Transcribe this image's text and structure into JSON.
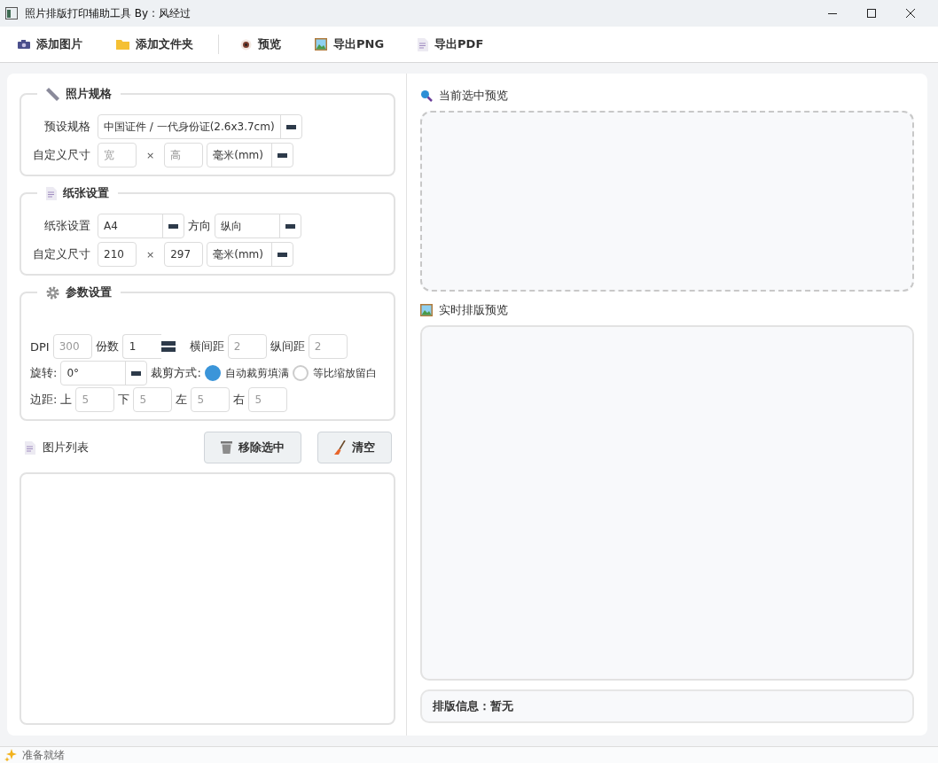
{
  "window": {
    "title": "照片排版打印辅助工具 By : 风经过"
  },
  "toolbar": {
    "groups": [
      {
        "buttons": [
          "添加图片",
          "添加文件夹"
        ]
      },
      {
        "buttons": [
          "预览",
          "导出PNG",
          "导出PDF"
        ]
      }
    ]
  },
  "sections": [
    {
      "title": "照片规格",
      "lines": [
        {
          "items": [
            {
              "kind": "label",
              "text": "预设规格"
            },
            {
              "kind": "select",
              "value": "中国证件 / 一代身份证(2.6x3.7cm)"
            }
          ]
        },
        {
          "items": [
            {
              "kind": "label",
              "text": "自定义尺寸"
            },
            {
              "kind": "input",
              "placeholder": "宽"
            },
            {
              "kind": "times",
              "text": "×"
            },
            {
              "kind": "input",
              "placeholder": "高"
            },
            {
              "kind": "select",
              "value": "毫米(mm)"
            }
          ]
        }
      ]
    },
    {
      "title": "纸张设置",
      "lines": [
        {
          "items": [
            {
              "kind": "label",
              "text": "纸张设置"
            },
            {
              "kind": "select",
              "value": "A4"
            },
            {
              "kind": "label",
              "text": "方向"
            },
            {
              "kind": "select",
              "value": "纵向"
            }
          ]
        },
        {
          "items": [
            {
              "kind": "label",
              "text": "自定义尺寸"
            },
            {
              "kind": "input",
              "value": "210"
            },
            {
              "kind": "times",
              "text": "×"
            },
            {
              "kind": "input",
              "value": "297"
            },
            {
              "kind": "select",
              "value": "毫米(mm)"
            }
          ]
        }
      ]
    },
    {
      "title": "参数设置",
      "lines": [
        {
          "items": [
            {
              "kind": "label",
              "text": "DPI"
            },
            {
              "kind": "input",
              "placeholder": "300"
            },
            {
              "kind": "label",
              "text": "份数"
            },
            {
              "kind": "spin",
              "value": "1"
            },
            {
              "kind": "label",
              "text": "横间距"
            },
            {
              "kind": "input",
              "placeholder": "2"
            },
            {
              "kind": "label",
              "text": "纵间距"
            },
            {
              "kind": "input",
              "placeholder": "2"
            }
          ]
        },
        {
          "items": [
            {
              "kind": "label",
              "text": "旋转:"
            },
            {
              "kind": "select",
              "value": "0°"
            },
            {
              "kind": "label",
              "text": "裁剪方式:"
            },
            {
              "kind": "radio",
              "label": "自动裁剪填满",
              "selected": true
            },
            {
              "kind": "radio",
              "label": "等比缩放留白",
              "selected": false
            }
          ]
        },
        {
          "items": [
            {
              "kind": "label",
              "text": "边距:"
            },
            {
              "kind": "label",
              "text": "上"
            },
            {
              "kind": "input",
              "placeholder": "5"
            },
            {
              "kind": "label",
              "text": "下"
            },
            {
              "kind": "input",
              "placeholder": "5"
            },
            {
              "kind": "label",
              "text": "左"
            },
            {
              "kind": "input",
              "placeholder": "5"
            },
            {
              "kind": "label",
              "text": "右"
            },
            {
              "kind": "input",
              "placeholder": "5"
            }
          ]
        }
      ]
    }
  ],
  "image_list": {
    "title": "图片列表",
    "buttons": [
      "移除选中",
      "清空"
    ]
  },
  "selected_preview": {
    "title": "当前选中预览"
  },
  "layout_preview": {
    "title": "实时排版预览"
  },
  "layout_info": "排版信息：暂无",
  "status_bar": {
    "text": "准备就绪"
  }
}
